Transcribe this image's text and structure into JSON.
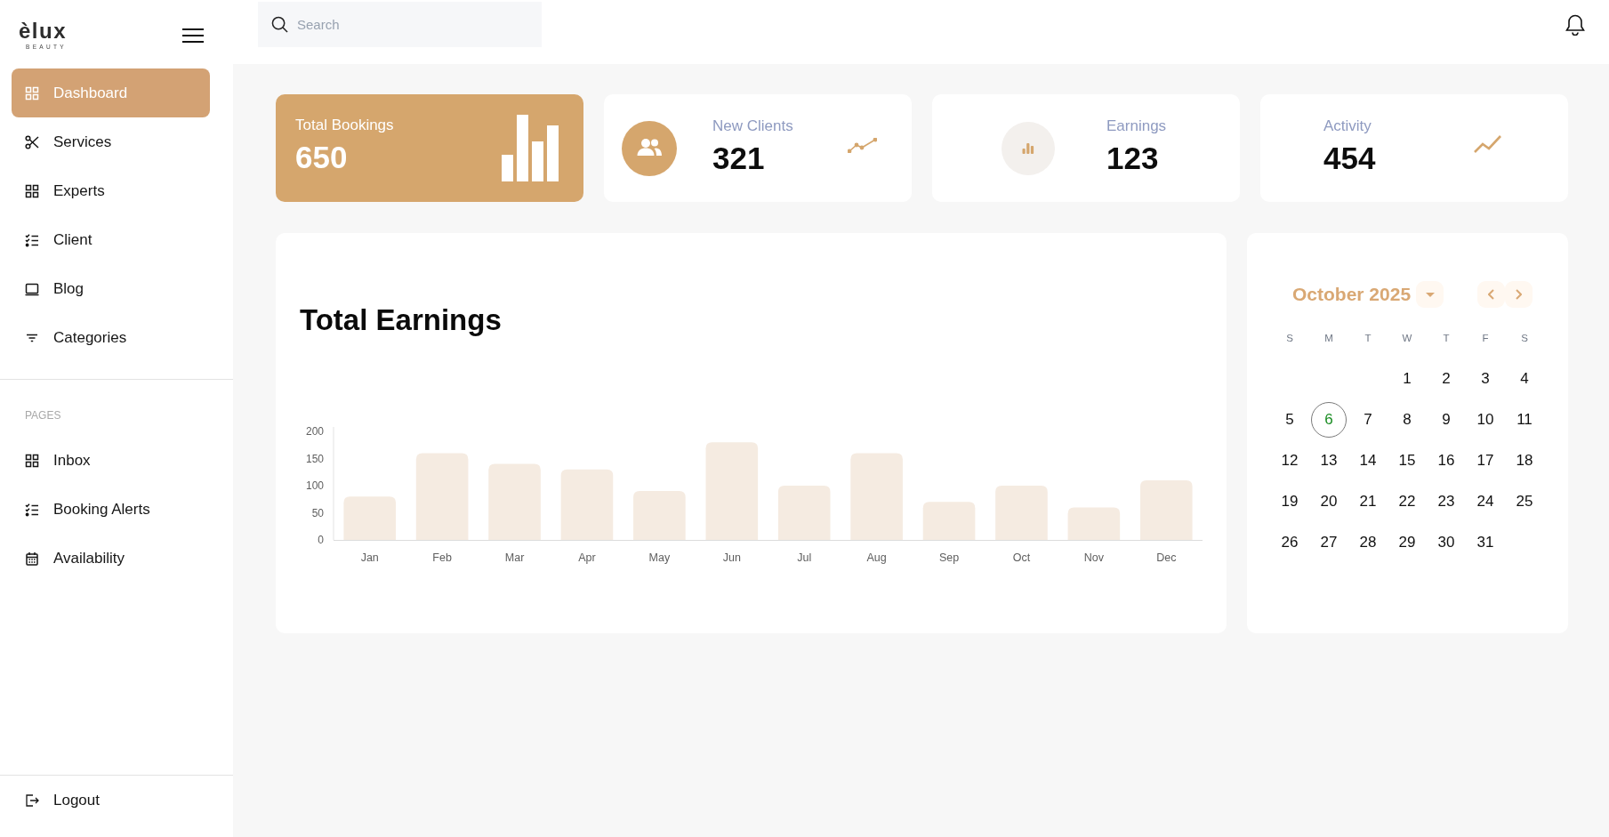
{
  "sidebar": {
    "logo": {
      "name": "èlux",
      "tagline": "BEAUTY"
    },
    "menu": [
      {
        "label": "Dashboard",
        "selected": true
      },
      {
        "label": "Services",
        "selected": false
      },
      {
        "label": "Experts",
        "selected": false
      },
      {
        "label": "Client",
        "selected": false
      },
      {
        "label": "Blog",
        "selected": false
      },
      {
        "label": "Categories",
        "selected": false
      }
    ],
    "pages": {
      "heading": "PAGES",
      "items": [
        {
          "label": "Inbox",
          "selected": false
        },
        {
          "label": "Booking Alerts",
          "selected": false
        },
        {
          "label": "Availability",
          "selected": false
        }
      ]
    },
    "logout": {
      "label": "Logout"
    }
  },
  "topbar": {
    "search": {
      "placeholder": "Search"
    }
  },
  "stats": [
    {
      "kind": "highlight",
      "label": "Total Bookings",
      "value": "650"
    },
    {
      "kind": "avatar",
      "label": "New Clients",
      "value": "321"
    },
    {
      "kind": "badge",
      "label": "Earnings",
      "value": "123"
    },
    {
      "kind": "trend",
      "label": "Activity",
      "value": "454"
    }
  ],
  "earnings": {
    "title": "Total Earnings",
    "chart_data": {
      "type": "bar",
      "categories": [
        "Jan",
        "Feb",
        "Mar",
        "Apr",
        "May",
        "Jun",
        "Jul",
        "Aug",
        "Sep",
        "Oct",
        "Nov",
        "Dec"
      ],
      "values": [
        80,
        160,
        140,
        130,
        90,
        180,
        100,
        160,
        70,
        100,
        60,
        110
      ],
      "ylim": [
        0,
        200
      ],
      "yticks": [
        0,
        50,
        100,
        150,
        200
      ]
    }
  },
  "calendar": {
    "month": "October 2025",
    "weekdays": [
      "S",
      "M",
      "T",
      "W",
      "T",
      "F",
      "S"
    ],
    "weeks": [
      {
        "days": [
          {
            "label": "1",
            "today": false
          },
          {
            "label": "2",
            "today": false
          },
          {
            "label": "3",
            "today": false
          },
          {
            "label": "4",
            "today": false
          }
        ]
      },
      {
        "days": [
          {
            "label": "5",
            "today": false
          },
          {
            "label": "6",
            "today": true
          },
          {
            "label": "7",
            "today": false
          },
          {
            "label": "8",
            "today": false
          },
          {
            "label": "9",
            "today": false
          },
          {
            "label": "10",
            "today": false
          },
          {
            "label": "11",
            "today": false
          }
        ]
      },
      {
        "days": [
          {
            "label": "12",
            "today": false
          },
          {
            "label": "13",
            "today": false
          },
          {
            "label": "14",
            "today": false
          },
          {
            "label": "15",
            "today": false
          },
          {
            "label": "16",
            "today": false
          },
          {
            "label": "17",
            "today": false
          },
          {
            "label": "18",
            "today": false
          }
        ]
      },
      {
        "days": [
          {
            "label": "19",
            "today": false
          },
          {
            "label": "20",
            "today": false
          },
          {
            "label": "21",
            "today": false
          },
          {
            "label": "22",
            "today": false
          },
          {
            "label": "23",
            "today": false
          },
          {
            "label": "24",
            "today": false
          },
          {
            "label": "25",
            "today": false
          }
        ]
      },
      {
        "days": [
          {
            "label": "26",
            "today": false
          },
          {
            "label": "27",
            "today": false
          },
          {
            "label": "28",
            "today": false
          },
          {
            "label": "29",
            "today": false
          },
          {
            "label": "30",
            "today": false
          },
          {
            "label": "31",
            "today": false
          }
        ]
      }
    ]
  }
}
